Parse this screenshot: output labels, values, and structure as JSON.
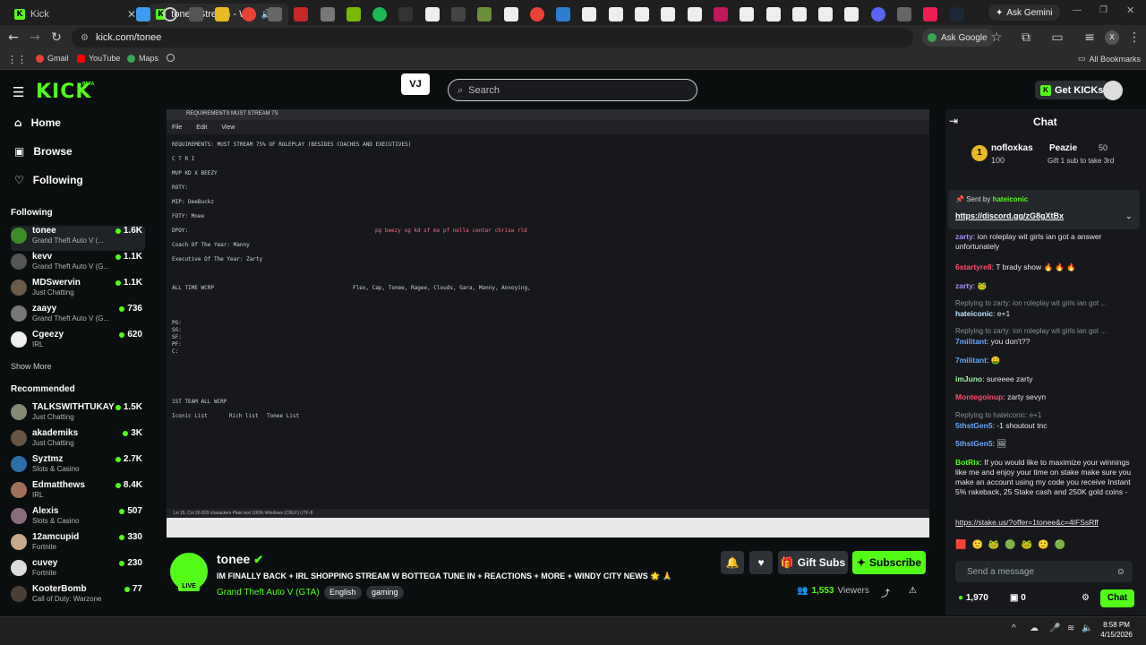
{
  "browser": {
    "tabs": [
      {
        "label": "Kick"
      },
      {
        "label": "tonee Stream - Watch Live"
      }
    ],
    "url": "kick.com/tonee",
    "ask_google": "Ask Google",
    "ask_gemini": "Ask Gemini",
    "bookmarks": [
      "Gmail",
      "YouTube",
      "Maps"
    ],
    "all_bookmarks": "All Bookmarks"
  },
  "kick": {
    "logo": "KICK",
    "beta": "BETA",
    "search_placeholder": "Search",
    "get_kicks": "Get KICKs",
    "accent": "#53fc18"
  },
  "sidebar": {
    "nav": [
      {
        "label": "Home",
        "icon": "home-icon"
      },
      {
        "label": "Browse",
        "icon": "browse-icon"
      },
      {
        "label": "Following",
        "icon": "heart-icon"
      }
    ],
    "following_title": "Following",
    "following": [
      {
        "name": "tonee",
        "game": "Grand Theft Auto V (...",
        "viewers": "1.6K"
      },
      {
        "name": "kevv",
        "game": "Grand Theft Auto V (G...",
        "viewers": "1.1K"
      },
      {
        "name": "MDSwervin",
        "game": "Just Chatting",
        "viewers": "1.1K"
      },
      {
        "name": "zaayy",
        "game": "Grand Theft Auto V (G...",
        "viewers": "736"
      },
      {
        "name": "Cgeezy",
        "game": "IRL",
        "viewers": "620"
      }
    ],
    "show_more": "Show More",
    "recommended_title": "Recommended",
    "recommended": [
      {
        "name": "TALKSWITHTUKAY",
        "game": "Just Chatting",
        "viewers": "1.5K"
      },
      {
        "name": "akademiks",
        "game": "Just Chatting",
        "viewers": "3K"
      },
      {
        "name": "Syztmz",
        "game": "Slots & Casino",
        "viewers": "2.7K"
      },
      {
        "name": "Edmatthews",
        "game": "IRL",
        "viewers": "8.4K"
      },
      {
        "name": "Alexis",
        "game": "Slots & Casino",
        "viewers": "507"
      },
      {
        "name": "12amcupid",
        "game": "Fortnite",
        "viewers": "330"
      },
      {
        "name": "cuvey",
        "game": "Fortnite",
        "viewers": "230"
      },
      {
        "name": "KooterBomb",
        "game": "Call of Duty: Warzone",
        "viewers": "77"
      }
    ]
  },
  "video_doc": {
    "tab": "REQUIREMENTS MUST STREAM 7S",
    "menu": [
      "File",
      "Edit",
      "View"
    ],
    "lines": [
      "REQUIREMENTS: MUST STREAM 75% OF ROLEPLAY (BESIDES COACHES AND EXECUTIVES)",
      "C T R I",
      "MVP KD X BEEZY",
      "ROTY:",
      "MIP: DeeBuckz",
      "FOTY: Moee",
      "DPOY:",
      "Coach Of The Year: Manny",
      "Executive Of The Year: Zarty",
      "ALL TIME WCRP",
      "PG:",
      "SG:",
      "SF:",
      "PF:",
      "C:",
      "1ST TEAM ALL WCRP",
      "Iconic List",
      "Rich list",
      "Tonee List"
    ],
    "dpoy_right": "pg beezy sg kd sf mo pf nella center chrisw rld",
    "alltime_right": "Flex, Cap, Tonee, Ragee, Clouds, Gara, Manny, Annoying,",
    "status": "Ln 15, Col 26   829 characters   Plain text   100%   Windows (CRLF)   UTF-8"
  },
  "stream": {
    "name": "tonee",
    "live": "LIVE",
    "title": "IM FINALLY BACK + IRL SHOPPING STREAM W BOTTEGA TUNE IN + REACTIONS + MORE + WINDY CITY NEWS 🌟 🙏",
    "category": "Grand Theft Auto V (GTA)",
    "tags": [
      "English",
      "gaming"
    ],
    "viewers": "1,553",
    "viewers_label": "Viewers",
    "gift_subs": "Gift Subs",
    "subscribe": "Subscribe"
  },
  "chat": {
    "title": "Chat",
    "leaderboard": [
      {
        "name": "nofloxkas",
        "amount": "100"
      },
      {
        "name": "Peazie",
        "amount": "50"
      }
    ],
    "gift_hint": "Gift 1 sub to take 3rd",
    "pinned_by": "Sent by",
    "pinned_user": "hateiconic",
    "pinned_link": "https://discord.gg/zG8gXtBx",
    "messages": [
      {
        "user": "zarty",
        "color": "#a78bfa",
        "text": ": ion roleplay wit girls ian got a answer unfortunately"
      },
      {
        "user": "6startyre8",
        "color": "#ff4d6d",
        "text": ": T brady show 🔥 🔥 🔥"
      },
      {
        "user": "zarty",
        "color": "#a78bfa",
        "text": ": 🐸"
      },
      {
        "reply": "Replying to zarty: ion roleplay wit girls ian got ..."
      },
      {
        "user": "hateiconic",
        "color": "#bfe3ff",
        "text": ": e+1"
      },
      {
        "reply": "Replying to zarty: ion roleplay wit girls ian got ..."
      },
      {
        "user": "7militant",
        "color": "#6aa6ff",
        "text": ": you don't??"
      },
      {
        "user": "7militant",
        "color": "#6aa6ff",
        "text": ": 🤑"
      },
      {
        "user": "imJuno",
        "color": "#9cf2a6",
        "text": ": sureeee zarty"
      },
      {
        "user": "Montegoinup",
        "color": "#ff4d6d",
        "text": ": zarty sevyn"
      },
      {
        "reply": "Replying to hateiconic: e+1"
      },
      {
        "user": "5thstGen5",
        "color": "#6aa6ff",
        "text": ": -1 shoutout tnc"
      },
      {
        "user": "5thstGen5",
        "color": "#6aa6ff",
        "text": ": 🖼"
      },
      {
        "user": "BotRix",
        "color": "#53fc18",
        "text": ": If you would like to maximize your winnings like me and enjoy your time on stake make sure you make an account using my code you receive Instant 5% rakeback, 25 Stake cash and 250K gold coins -"
      },
      {
        "link": "https://stake.us/?offer=1tonee&c=4IFSsRff"
      }
    ],
    "send_placeholder": "Send a message",
    "points": "1,970",
    "count": "0",
    "chat_button": "Chat"
  },
  "taskbar": {
    "time": "8:58 PM",
    "date": "4/15/2026"
  }
}
